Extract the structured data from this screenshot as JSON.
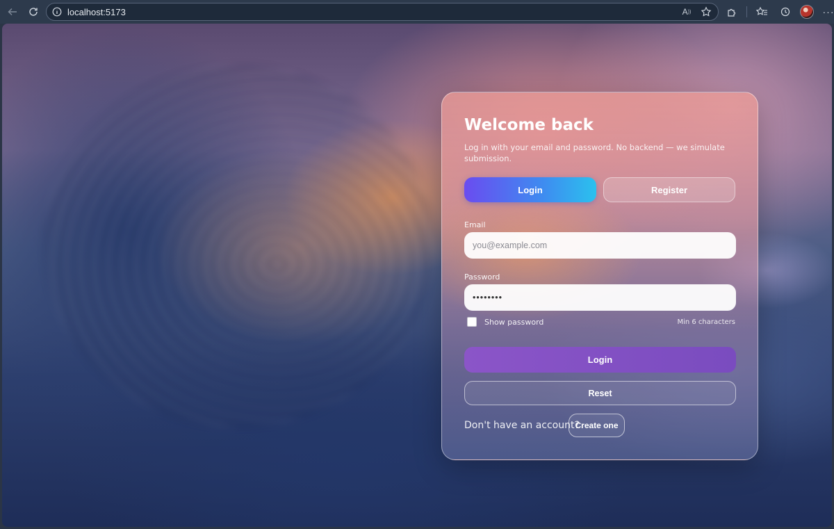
{
  "browser": {
    "url": "localhost:5173"
  },
  "card": {
    "title": "Welcome back",
    "subtitle": "Log in with your email and password. No backend — we simulate submission.",
    "tabs": [
      {
        "label": "Login",
        "active": true
      },
      {
        "label": "Register",
        "active": false
      }
    ],
    "email": {
      "label": "Email",
      "placeholder": "you@example.com",
      "value": ""
    },
    "password": {
      "label": "Password",
      "value": "••••••••"
    },
    "show_password_label": "Show password",
    "show_password_checked": false,
    "password_hint": "Min 6 characters",
    "submit_label": "Login",
    "reset_label": "Reset",
    "footer_text": "Don't have an account?",
    "create_label": "Create one"
  },
  "colors": {
    "accent_gradient_start": "#6a4cf0",
    "accent_gradient_end": "#2bc1ee",
    "primary_button": "#8b55c8"
  }
}
